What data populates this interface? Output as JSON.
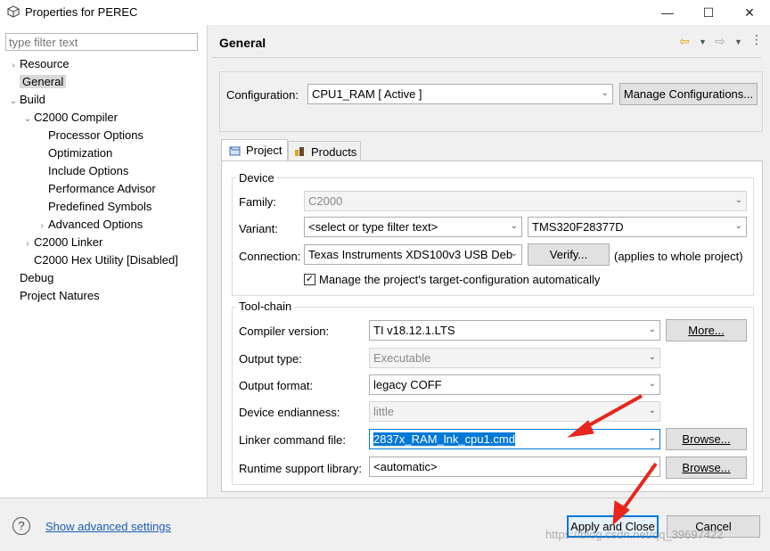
{
  "window": {
    "title": "Properties for PEREC",
    "minimize_glyph": "—",
    "maximize_glyph": "☐",
    "close_glyph": "✕"
  },
  "sidebar": {
    "filter_placeholder": "type filter text",
    "items": [
      {
        "label": "Resource",
        "level": 0,
        "arrow": "›"
      },
      {
        "label": "General",
        "level": 0,
        "arrow": "",
        "selected": true
      },
      {
        "label": "Build",
        "level": 0,
        "arrow": "⌄"
      },
      {
        "label": "C2000 Compiler",
        "level": 1,
        "arrow": "⌄"
      },
      {
        "label": "Processor Options",
        "level": 2,
        "arrow": ""
      },
      {
        "label": "Optimization",
        "level": 2,
        "arrow": ""
      },
      {
        "label": "Include Options",
        "level": 2,
        "arrow": ""
      },
      {
        "label": "Performance Advisor",
        "level": 2,
        "arrow": ""
      },
      {
        "label": "Predefined Symbols",
        "level": 2,
        "arrow": ""
      },
      {
        "label": "Advanced Options",
        "level": 2,
        "arrow": "›"
      },
      {
        "label": "C2000 Linker",
        "level": 1,
        "arrow": "›"
      },
      {
        "label": "C2000 Hex Utility  [Disabled]",
        "level": 1,
        "arrow": ""
      },
      {
        "label": "Debug",
        "level": 0,
        "arrow": ""
      },
      {
        "label": "Project Natures",
        "level": 0,
        "arrow": ""
      }
    ]
  },
  "page": {
    "title": "General"
  },
  "configuration": {
    "label": "Configuration:",
    "value": "CPU1_RAM  [ Active ]",
    "manage_button": "Manage Configurations..."
  },
  "tabs": [
    {
      "label": "Project",
      "active": true
    },
    {
      "label": "Products",
      "active": false
    }
  ],
  "device": {
    "group_title": "Device",
    "family_label": "Family:",
    "family_value": "C2000",
    "variant_label": "Variant:",
    "variant_filter": "<select or type filter text>",
    "variant_value": "TMS320F28377D",
    "connection_label": "Connection:",
    "connection_value": "Texas Instruments XDS100v3 USB Deb",
    "verify_button": "Verify...",
    "applies_note": "(applies to whole project)",
    "manage_target_checked": true,
    "manage_target_label": "Manage the project's target-configuration automatically"
  },
  "toolchain": {
    "group_title": "Tool-chain",
    "compiler_label": "Compiler version:",
    "compiler_value": "TI v18.12.1.LTS",
    "more_button": "More...",
    "output_type_label": "Output type:",
    "output_type_value": "Executable",
    "output_format_label": "Output format:",
    "output_format_value": "legacy COFF",
    "endianness_label": "Device endianness:",
    "endianness_value": "little",
    "linker_cmd_label": "Linker command file:",
    "linker_cmd_value": "2837x_RAM_lnk_cpu1.cmd",
    "browse_button_1": "Browse...",
    "runtime_label": "Runtime support library:",
    "runtime_value": "<automatic>",
    "browse_button_2": "Browse..."
  },
  "footer": {
    "help_glyph": "?",
    "advanced_link": "Show advanced settings",
    "apply_close_button": "Apply and Close",
    "cancel_button": "Cancel",
    "watermark": "https://blog.csdn.net/qq_39697422"
  },
  "colors": {
    "annotation_arrow": "#e8261c",
    "link": "#1a5fb4",
    "selection": "#0078d7"
  }
}
